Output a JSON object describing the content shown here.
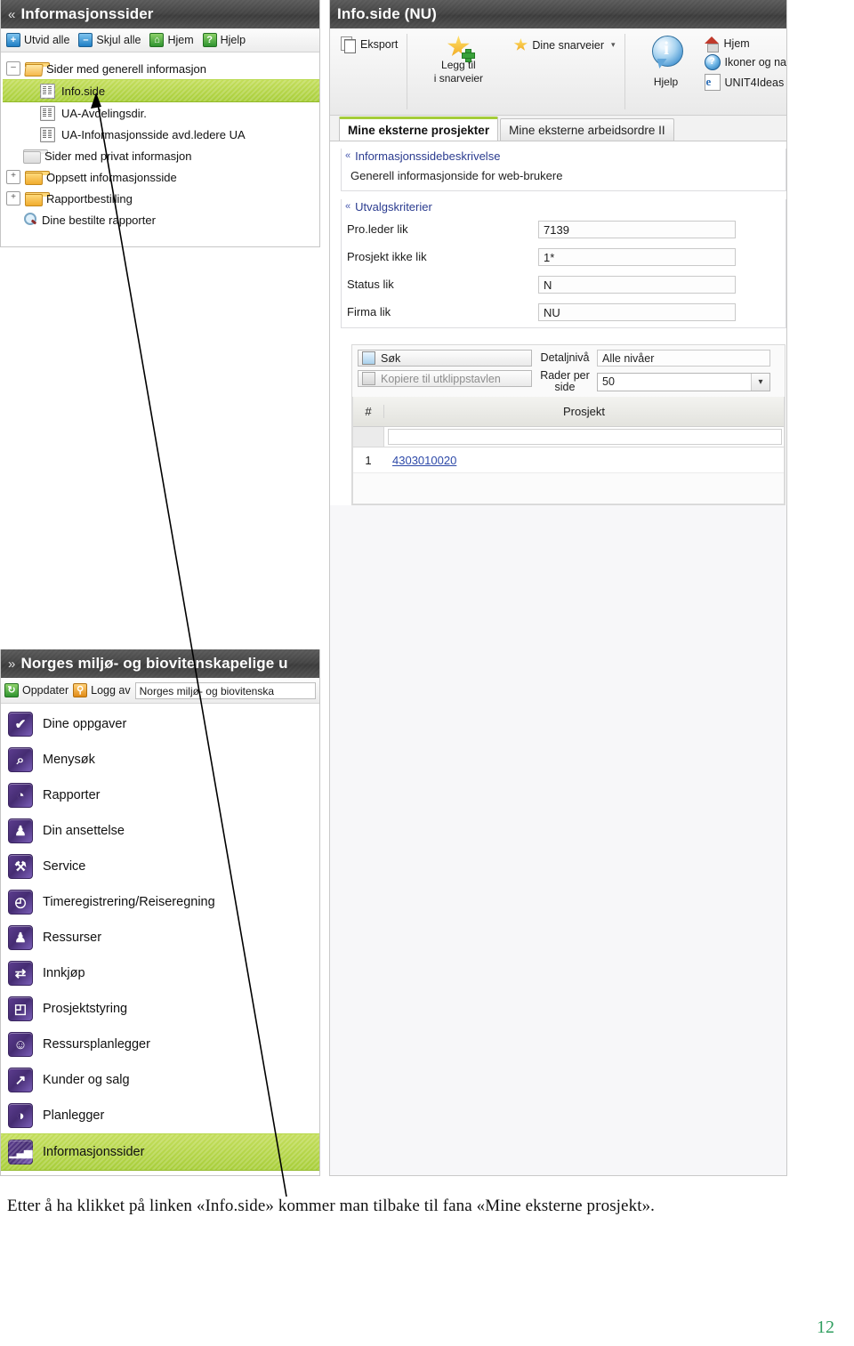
{
  "left_tree_panel": {
    "title": "Informasjonssider",
    "title_chevron": "«",
    "toolbar": [
      {
        "label": "Utvid alle",
        "icon": "plus-square-icon",
        "glyph": "+"
      },
      {
        "label": "Skjul alle",
        "icon": "minus-square-icon",
        "glyph": "–"
      },
      {
        "label": "Hjem",
        "icon": "home-icon",
        "glyph": "⌂"
      },
      {
        "label": "Hjelp",
        "icon": "question-icon",
        "glyph": "?"
      }
    ],
    "nodes": [
      {
        "label": "Sider med generell informasjon",
        "expander": "–",
        "icon": "folder-open-icon",
        "level": 1,
        "selected": false
      },
      {
        "label": "Info.side",
        "expander": "",
        "icon": "info-page-icon",
        "level": 2,
        "selected": true
      },
      {
        "label": "UA-Avdelingsdir.",
        "expander": "",
        "icon": "info-page-icon",
        "level": 2,
        "selected": false
      },
      {
        "label": "UA-Informasjonsside avd.ledere UA",
        "expander": "",
        "icon": "info-page-icon",
        "level": 2,
        "selected": false
      },
      {
        "label": "Sider med privat informasjon",
        "expander": "",
        "icon": "folder-disabled-icon",
        "level": 1,
        "selected": false
      },
      {
        "label": "Oppsett informasjonsside",
        "expander": "+",
        "icon": "folder-icon",
        "level": 1,
        "selected": false
      },
      {
        "label": "Rapportbestilling",
        "expander": "+",
        "icon": "folder-icon",
        "level": 1,
        "selected": false
      },
      {
        "label": "Dine bestilte rapporter",
        "expander": "",
        "icon": "magnifier-icon",
        "level": 1,
        "selected": false
      }
    ]
  },
  "info_page": {
    "title": "Info.side (NU)",
    "ribbon": {
      "export_label": "Eksport",
      "add_shortcut_label_line1": "Legg til",
      "add_shortcut_label_line2": "i snarveier",
      "your_shortcuts_label": "Dine snarveier",
      "your_shortcuts_caret": "▾",
      "help_label": "Hjelp",
      "links": [
        {
          "label": "Hjem",
          "icon": "home-icon"
        },
        {
          "label": "Ikoner og navi",
          "icon": "question-circle-icon"
        },
        {
          "label": "UNIT4Ideas",
          "icon": "internet-explorer-icon"
        }
      ]
    },
    "tabs": [
      {
        "label": "Mine eksterne prosjekter",
        "active": true
      },
      {
        "label": "Mine eksterne arbeidsordre II",
        "active": false
      }
    ],
    "description_section": {
      "legend": "Informasjonssidebeskrivelse",
      "chevron": "«",
      "text": "Generell informasjonside for web-brukere"
    },
    "criteria_section": {
      "legend": "Utvalgskriterier",
      "chevron": "«",
      "fields": [
        {
          "label": "Pro.leder lik",
          "value": "7139"
        },
        {
          "label": "Prosjekt ikke lik",
          "value": "1*"
        },
        {
          "label": "Status lik",
          "value": "N"
        },
        {
          "label": "Firma lik",
          "value": "NU"
        }
      ]
    },
    "search_panel": {
      "search_button": "Søk",
      "copy_button": "Kopiere til utklippstavlen",
      "detail_level_label": "Detaljnivå",
      "detail_level_value": "Alle nivåer",
      "rows_per_page_label_line1": "Rader per",
      "rows_per_page_label_line2": "side",
      "rows_per_page_value": "50",
      "dropdown_caret": "▾"
    },
    "result_grid": {
      "columns": [
        "#",
        "Prosjekt"
      ],
      "rows": [
        {
          "num": "1",
          "prosjekt": "4303010020"
        }
      ]
    }
  },
  "left_menu_panel": {
    "title": "Norges miljø- og biovitenskapelige u",
    "title_chevron": "»",
    "toolbar": {
      "refresh_label": "Oppdater",
      "logout_label": "Logg av",
      "company_field": "Norges miljø- og biovitenska"
    },
    "items": [
      {
        "label": "Dine oppgaver",
        "icon": "checkmark-icon",
        "glyph": "✔",
        "selected": false
      },
      {
        "label": "Menysøk",
        "icon": "magnifier-icon",
        "glyph": "⌕",
        "selected": false
      },
      {
        "label": "Rapporter",
        "icon": "pie-chart-icon",
        "glyph": "◔",
        "selected": false
      },
      {
        "label": "Din ansettelse",
        "icon": "person-gear-icon",
        "glyph": "♟",
        "selected": false
      },
      {
        "label": "Service",
        "icon": "wrench-icon",
        "glyph": "⚒",
        "selected": false
      },
      {
        "label": "Timeregistrering/Reiseregning",
        "icon": "clock-euro-icon",
        "glyph": "◴",
        "selected": false
      },
      {
        "label": "Ressurser",
        "icon": "people-icon",
        "glyph": "♟",
        "selected": false
      },
      {
        "label": "Innkjøp",
        "icon": "exchange-arrows-icon",
        "glyph": "⇄",
        "selected": false
      },
      {
        "label": "Prosjektstyring",
        "icon": "project-blocks-icon",
        "glyph": "◰",
        "selected": false
      },
      {
        "label": "Ressursplanlegger",
        "icon": "person-clock-icon",
        "glyph": "☺",
        "selected": false
      },
      {
        "label": "Kunder og salg",
        "icon": "line-chart-icon",
        "glyph": "↗",
        "selected": false
      },
      {
        "label": "Planlegger",
        "icon": "planner-circle-icon",
        "glyph": "◑",
        "selected": false
      },
      {
        "label": "Informasjonssider",
        "icon": "bar-chart-icon",
        "glyph": "█",
        "selected": true
      }
    ]
  },
  "annotation": {
    "description": "arrow pointing from caption up to the Info.side tree node"
  },
  "caption": {
    "text": "Etter å ha klikket på linken «Info.side» kommer man tilbake til fana «Mine eksterne prosjekt»."
  },
  "page_number": "12",
  "colors": {
    "selection_green": "#b4d646",
    "title_bar_dark": "#4a4a4a",
    "link_blue": "#2d49a8",
    "legend_blue": "#2a3b8f",
    "menu_icon_purple": "#4c3080",
    "page_number_green": "#2f9e5f"
  }
}
